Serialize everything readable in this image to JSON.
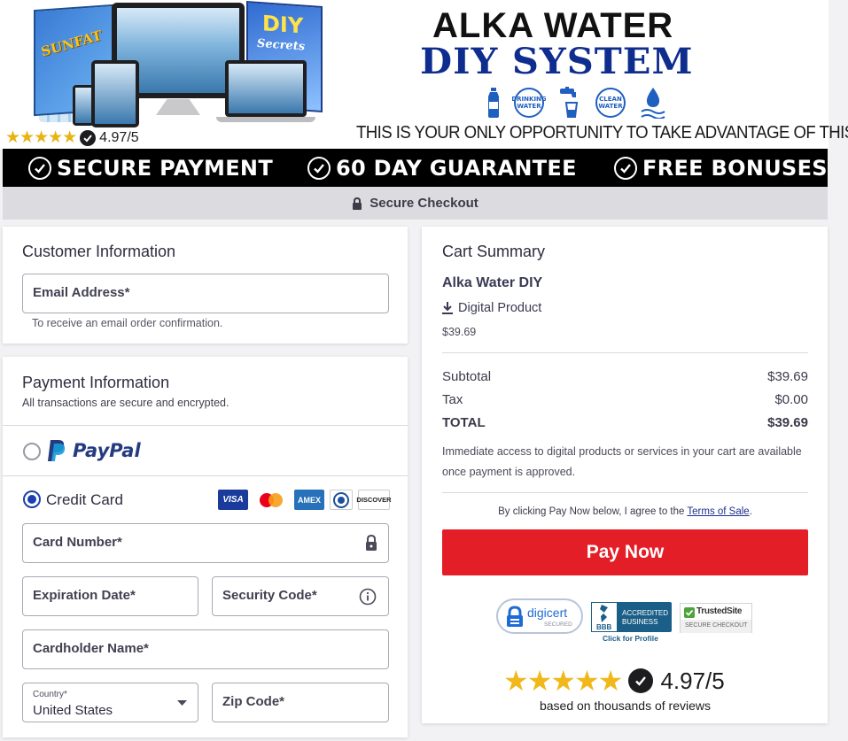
{
  "hero": {
    "title_line1": "ALKA WATER",
    "title_line2": "DIY SYSTEM",
    "book_left_text": "SUNFAT",
    "book_right_text": "DIY",
    "book_right_subtext": "Secrets",
    "icons": [
      "water-bottle-icon",
      "drinking-water-icon",
      "faucet-icon",
      "clean-water-icon",
      "water-drop-icon"
    ],
    "icon_labels": {
      "drinking": "DRINKING WATER",
      "clean": "CLEAN WATER"
    },
    "tagline": "THIS IS YOUR ONLY OPPORTUNITY TO TAKE ADVANTAGE OF THIS",
    "rating_stars": "★★★★★",
    "rating": "4.97/5"
  },
  "banner": {
    "items": [
      "SECURE PAYMENT",
      "60 DAY GUARANTEE",
      "FREE BONUSES"
    ]
  },
  "secure_checkout": "Secure Checkout",
  "customer": {
    "title": "Customer Information",
    "email_label": "Email Address*",
    "email_help": "To receive an email order confirmation."
  },
  "payment": {
    "title": "Payment Information",
    "subtitle": "All transactions are secure and encrypted.",
    "paypal_label": "PayPal",
    "credit_label": "Credit Card",
    "card_logos": [
      "VISA",
      "mastercard",
      "AMEX",
      "diners",
      "DISCOVER"
    ],
    "card_number_label": "Card Number*",
    "expiration_label": "Expiration Date*",
    "security_label": "Security Code*",
    "cardholder_label": "Cardholder Name*",
    "country_small_label": "Country*",
    "country_value": "United States",
    "zip_label": "Zip Code*",
    "selected_method": "credit-card"
  },
  "cart": {
    "title": "Cart Summary",
    "product_name": "Alka Water DIY",
    "product_type": "Digital Product",
    "product_price": "$39.69",
    "subtotal_label": "Subtotal",
    "subtotal_value": "$39.69",
    "tax_label": "Tax",
    "tax_value": "$0.00",
    "total_label": "TOTAL",
    "total_value": "$39.69",
    "access_note": "Immediate access to digital products or services in your cart are available once payment is approved.",
    "agree_prefix": "By clicking Pay Now below, I agree to the ",
    "terms_link": "Terms of Sale",
    "agree_suffix": ".",
    "pay_button": "Pay Now",
    "badges": {
      "digicert_name": "digicert",
      "digicert_sub": "SECURED",
      "bbb_line1": "ACCREDITED",
      "bbb_line2": "BUSINESS",
      "bbb_logo_text": "BBB",
      "bbb_link": "Click for Profile",
      "trusted_name": "TrustedSite",
      "trusted_sub": "SECURE CHECKOUT"
    },
    "rating_stars": "★★★★★",
    "rating": "4.97/5",
    "rating_note": "based on thousands of reviews"
  },
  "colors": {
    "brand_blue": "#0f2d8f",
    "pay_red": "#e41e26",
    "star_gold": "#e7b416",
    "radio_blue": "#1c3fae"
  }
}
